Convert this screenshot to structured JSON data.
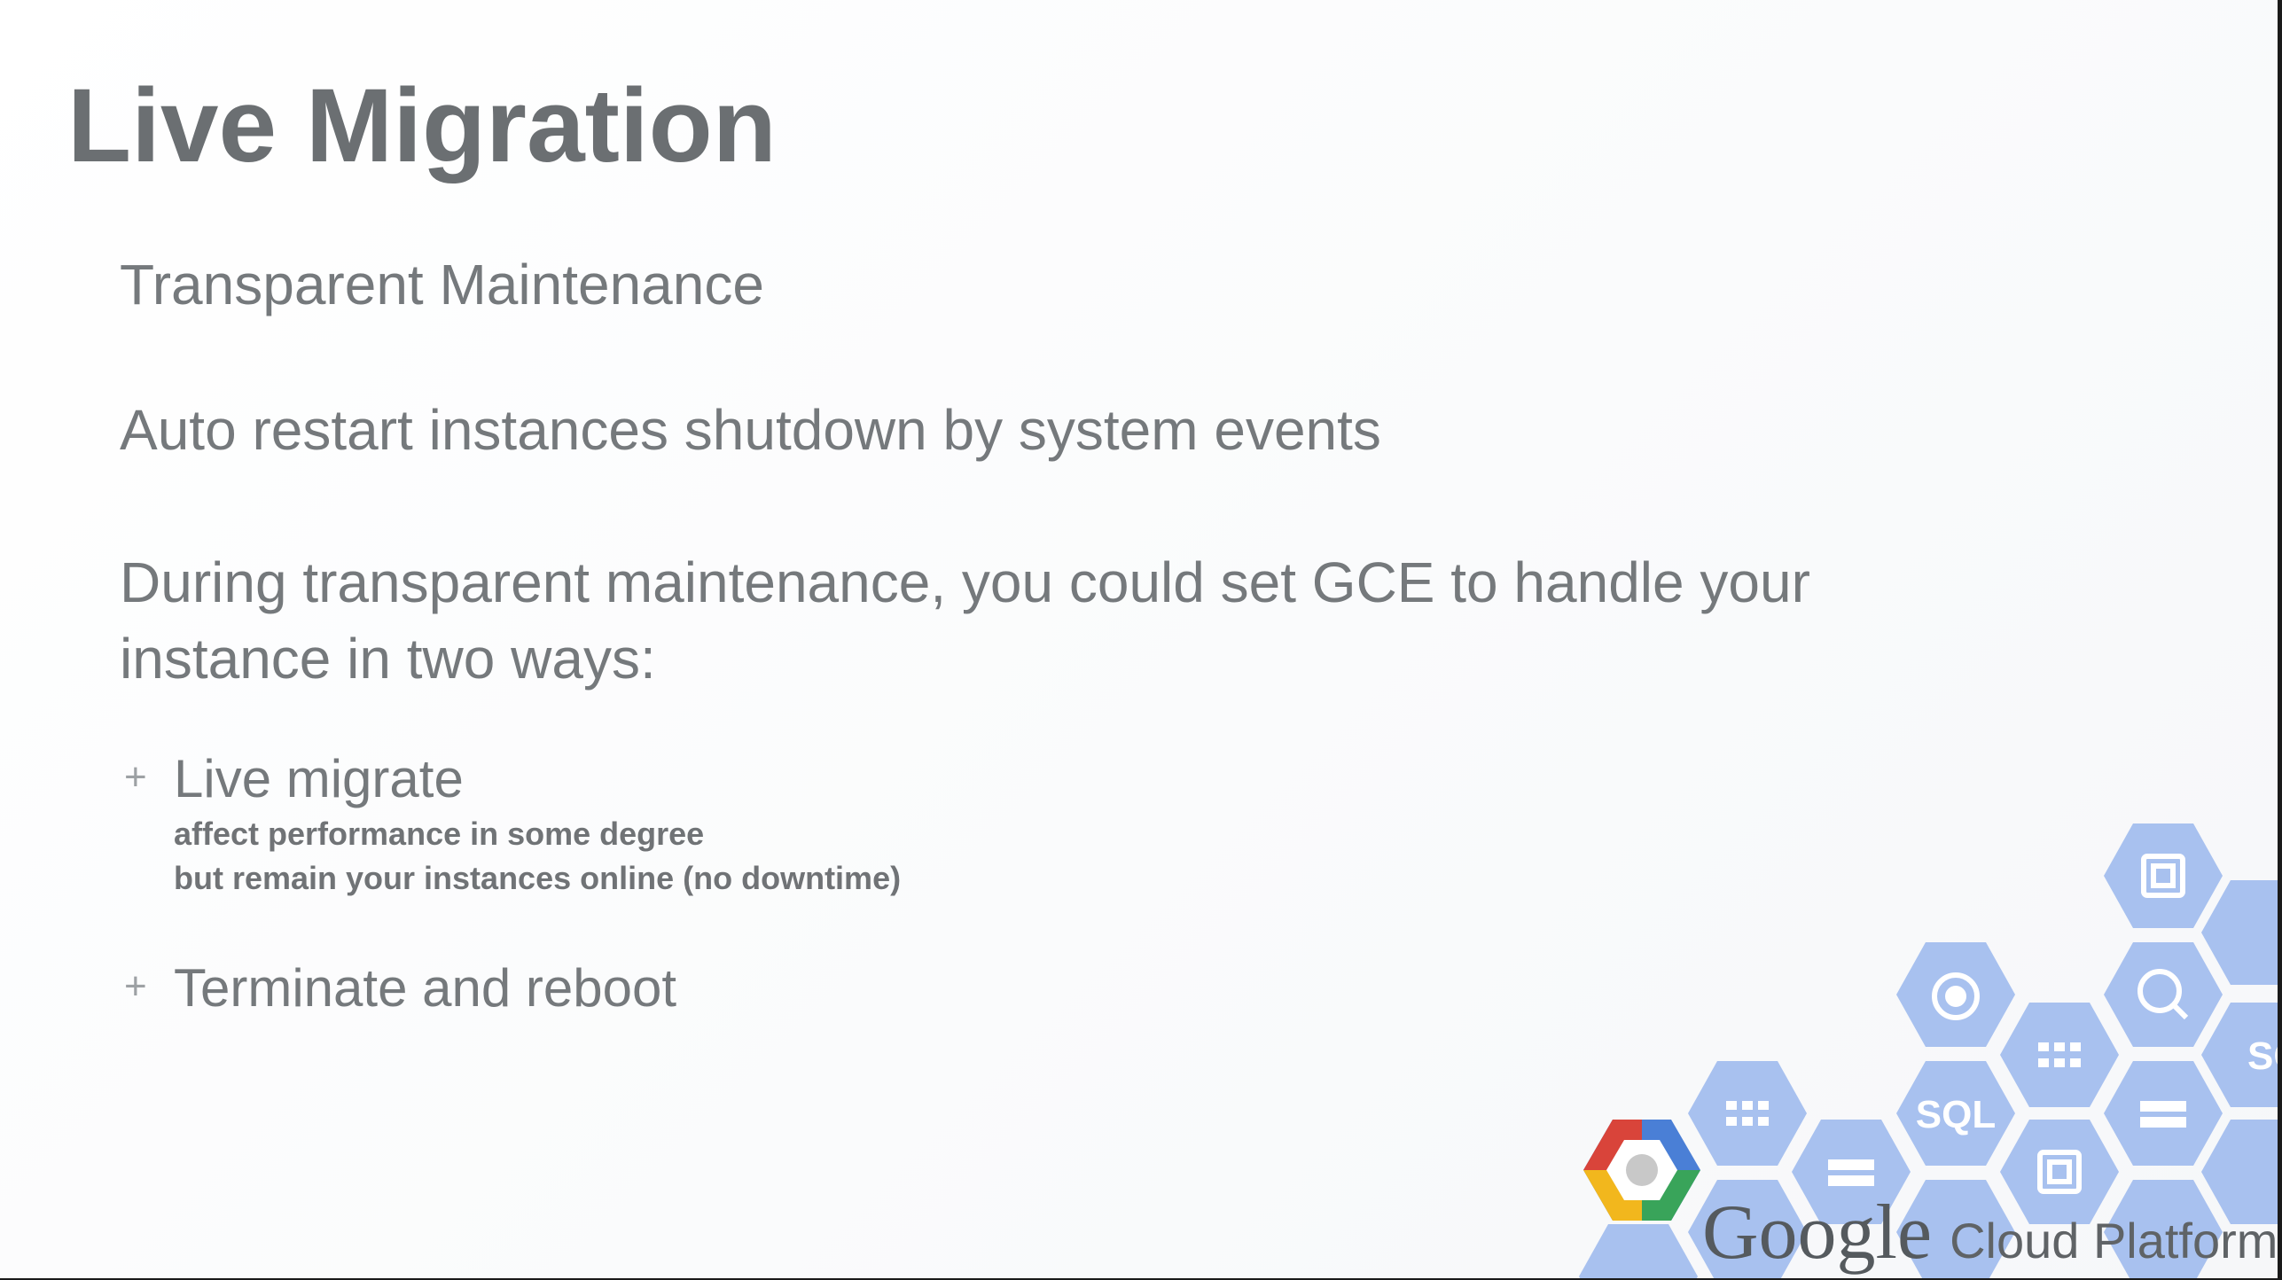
{
  "slide": {
    "title": "Live Migration",
    "paragraphs": [
      "Transparent Maintenance",
      "Auto restart instances shutdown by system events"
    ],
    "intro_line1": "During transparent maintenance, you could set GCE to handle your",
    "intro_line2": "instance in two ways:",
    "bullets": [
      {
        "marker": "+",
        "label": "Live migrate",
        "details": [
          "affect performance in some degree",
          "but remain your instances online (no downtime)"
        ]
      },
      {
        "marker": "+",
        "label": "Terminate and reboot"
      }
    ]
  },
  "branding": {
    "google": "Google",
    "product": "Cloud Platform",
    "hex_labels": [
      "SQL",
      "SQL"
    ]
  },
  "colors": {
    "hex_blue": "#a8c1ef",
    "logo_blue": "#4a7fd6",
    "logo_red": "#d9443a",
    "logo_yellow": "#f2b71d",
    "logo_green": "#39a45a"
  }
}
